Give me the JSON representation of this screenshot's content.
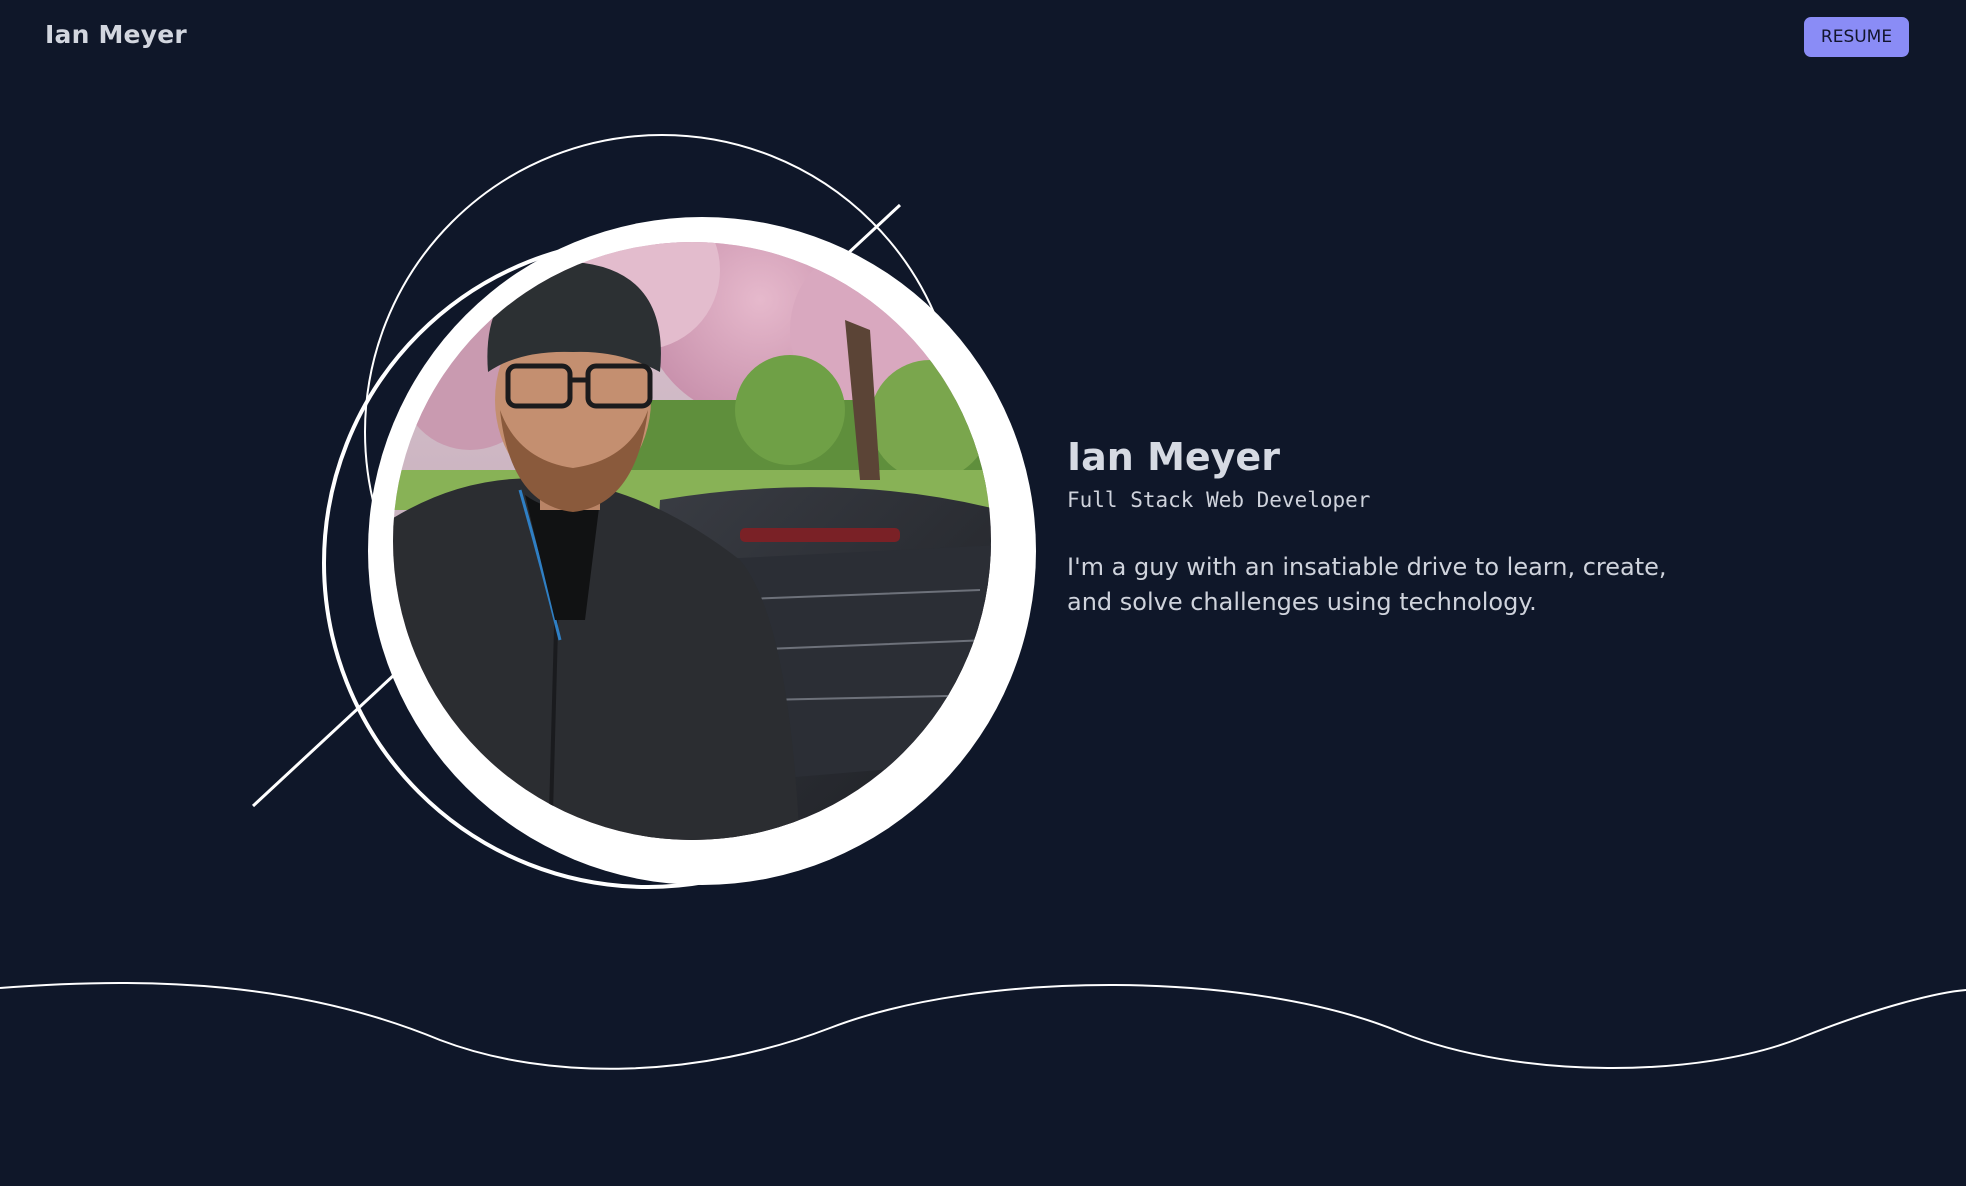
{
  "header": {
    "brand": "Ian Meyer",
    "resume_label": "RESUME"
  },
  "hero": {
    "name": "Ian Meyer",
    "role": "Full Stack Web Developer",
    "bio": "I'm a guy with an insatiable drive to learn, create, and solve challenges using technology."
  },
  "colors": {
    "background": "#0f1729",
    "accent": "#8a8cf6",
    "text": "#d6dae3",
    "line": "#ffffff"
  }
}
